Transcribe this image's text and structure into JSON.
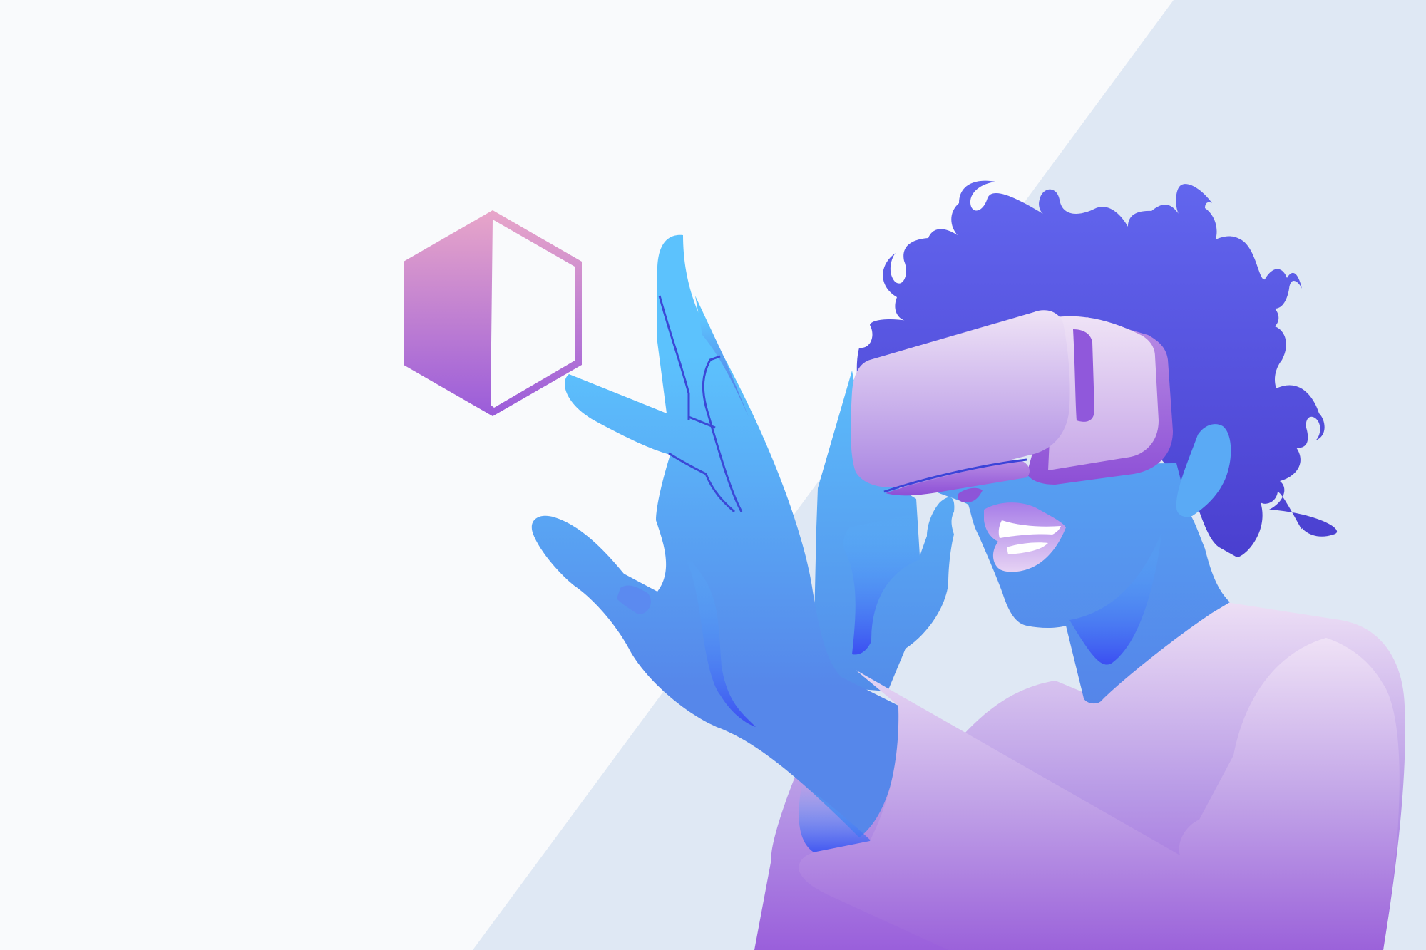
{
  "scene": {
    "subject": "person-wearing-vr-headset",
    "object": "hexagon-icon"
  },
  "colors": {
    "background": "#f9fafc",
    "background_band": "#dfe8f4",
    "hair_top": "#6266ee",
    "hair_bottom": "#4a3fcf",
    "skin_light": "#5cc2fd",
    "skin_dark": "#5687ea",
    "skin_deep": "#3b4ef2",
    "headset_light": "#efe3f6",
    "headset_mid": "#c7a6e6",
    "headset_dark": "#9a62dc",
    "shirt_light": "#eddff5",
    "shirt_dark": "#9a5fdb",
    "hexagon_top": "#e8a6c9",
    "hexagon_bottom": "#9a5cda"
  }
}
